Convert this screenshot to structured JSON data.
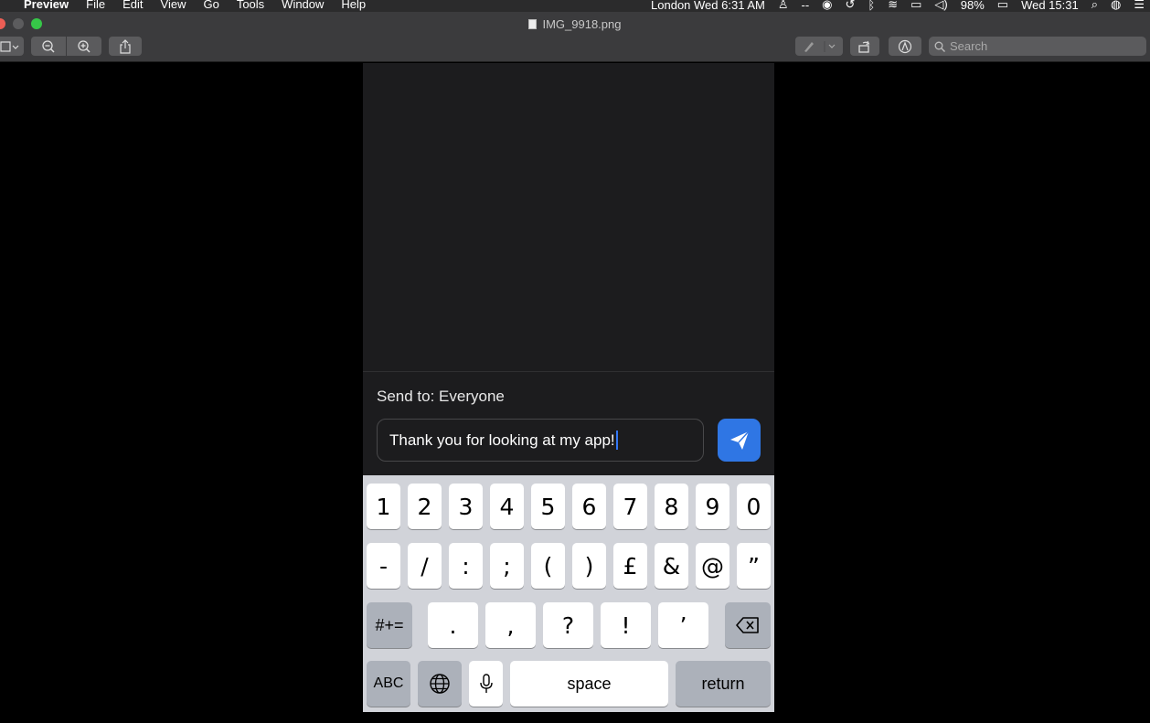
{
  "menubar": {
    "app_name": "Preview",
    "menus": [
      "File",
      "Edit",
      "View",
      "Go",
      "Tools",
      "Window",
      "Help"
    ],
    "clock_london": "London Wed 6:31 AM",
    "battery": "98%",
    "clock": "Wed 15:31",
    "status_dash": "--"
  },
  "window": {
    "title": "IMG_9918.png",
    "search_placeholder": "Search"
  },
  "app": {
    "send_to": "Send to: Everyone",
    "message": "Thank you for looking at my app!"
  },
  "keyboard": {
    "row1": [
      "1",
      "2",
      "3",
      "4",
      "5",
      "6",
      "7",
      "8",
      "9",
      "0"
    ],
    "row2": [
      "-",
      "/",
      ":",
      ";",
      "(",
      ")",
      "£",
      "&",
      "@",
      "”"
    ],
    "row3": [
      ".",
      ",",
      "?",
      "!",
      "’"
    ],
    "symbols_key": "#+=",
    "abc_key": "ABC",
    "space_key": "space",
    "return_key": "return"
  },
  "colors": {
    "send_button": "#2f76e4",
    "caret": "#3478f6",
    "keyboard_bg": "#d1d3d9"
  }
}
